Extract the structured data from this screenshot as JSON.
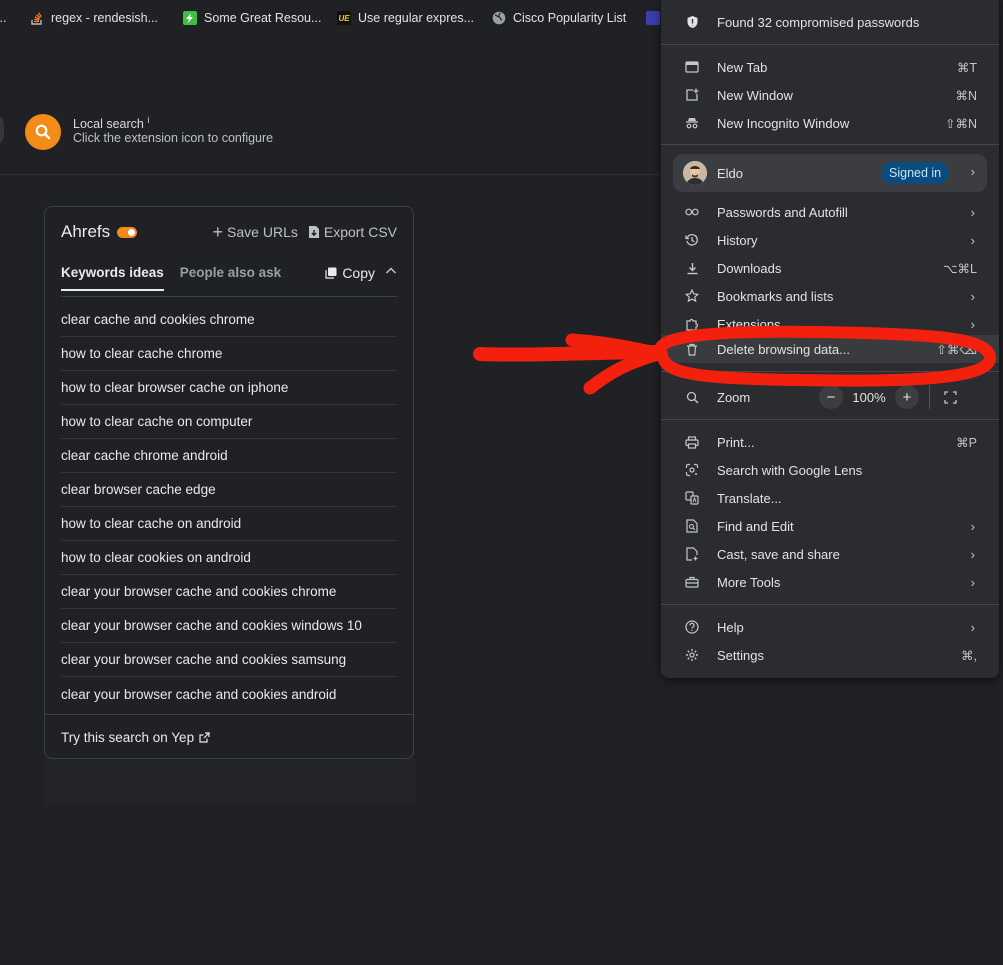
{
  "bookmarks": [
    {
      "label": "...",
      "icon": "bookmark-clip-icon"
    },
    {
      "label": "regex - rendesish...",
      "icon": "stackoverflow-icon"
    },
    {
      "label": "Some Great Resou...",
      "icon": "green-bolt-icon"
    },
    {
      "label": "Use regular expres...",
      "icon": "ue-icon"
    },
    {
      "label": "Cisco Popularity List",
      "icon": "globe-icon"
    }
  ],
  "local_search": {
    "title": "Local search",
    "info": "i",
    "subtitle": "Click the extension icon to configure"
  },
  "ahrefs": {
    "brand": "Ahrefs",
    "save_urls": "Save URLs",
    "export_csv": "Export CSV",
    "tabs": [
      {
        "label": "Keywords ideas",
        "active": true
      },
      {
        "label": "People also ask",
        "active": false
      }
    ],
    "copy": "Copy",
    "keywords": [
      "clear cache and cookies chrome",
      "how to clear cache chrome",
      "how to clear browser cache on iphone",
      "how to clear cache on computer",
      "clear cache chrome android",
      "clear browser cache edge",
      "how to clear cache on android",
      "how to clear cookies on android",
      "clear your browser cache and cookies chrome",
      "clear your browser cache and cookies windows 10",
      "clear your browser cache and cookies samsung",
      "clear your browser cache and cookies android"
    ],
    "footer": "Try this search on Yep"
  },
  "menu": {
    "compromised": "Found 32 compromised passwords",
    "new_tab": {
      "label": "New Tab",
      "shortcut": "⌘T"
    },
    "new_window": {
      "label": "New Window",
      "shortcut": "⌘N"
    },
    "incognito": {
      "label": "New Incognito Window",
      "shortcut": "⇧⌘N"
    },
    "profile": {
      "name": "Eldo",
      "badge": "Signed in"
    },
    "passwords": "Passwords and Autofill",
    "history": "History",
    "downloads": {
      "label": "Downloads",
      "shortcut": "⌥⌘L"
    },
    "bookmarks": "Bookmarks and lists",
    "extensions": "Extensions",
    "delete_data": {
      "label": "Delete browsing data...",
      "shortcut": "⇧⌘⌫"
    },
    "zoom": {
      "label": "Zoom",
      "minus": "−",
      "value": "100%",
      "plus": "+"
    },
    "print": {
      "label": "Print...",
      "shortcut": "⌘P"
    },
    "lens": "Search with Google Lens",
    "translate": "Translate...",
    "find_edit": "Find and Edit",
    "cast": "Cast, save and share",
    "more_tools": "More Tools",
    "help": "Help",
    "settings": {
      "label": "Settings",
      "shortcut": "⌘,"
    },
    "arrow": "›"
  },
  "colors": {
    "background": "#202124",
    "menu_bg": "#2b2c2f",
    "accent_orange": "#f28b18",
    "annotation_red": "#f2200d",
    "signed_in_badge": "#0b4b7d"
  }
}
